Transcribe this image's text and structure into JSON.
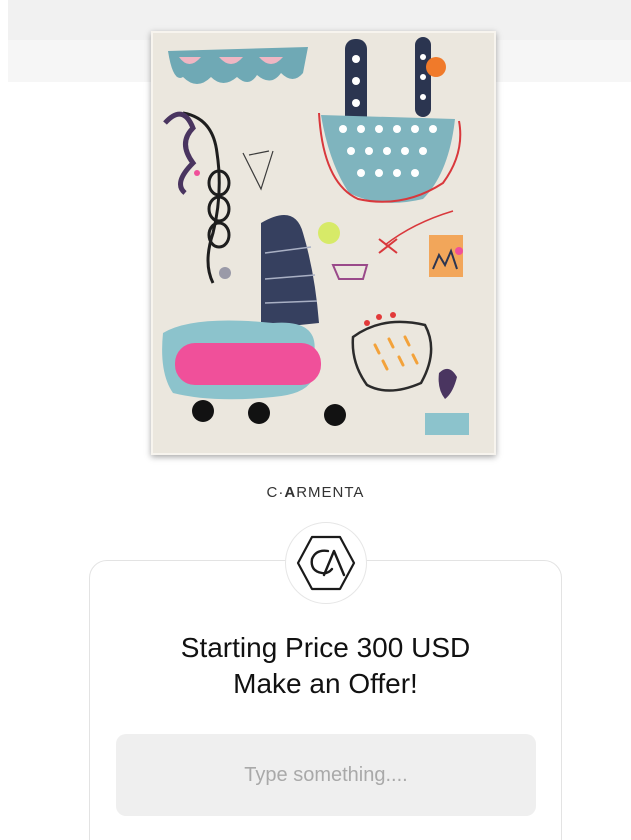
{
  "artwork": {
    "description_icon": "abstract-painting-image"
  },
  "brand": {
    "initial": "C",
    "dot": "·",
    "bold_letter": "A",
    "rest": "RMENTA"
  },
  "logo": {
    "icon": "ca-hexagon-logo-icon"
  },
  "offer": {
    "line1": "Starting Price 300 USD",
    "line2": "Make an Offer!"
  },
  "input": {
    "placeholder": "Type something....",
    "value": ""
  },
  "colors": {
    "canvas": "#ece8df",
    "pink": "#f0509a",
    "teal": "#7fb8c3",
    "navy": "#2f3a55",
    "input_bg": "#efefef"
  }
}
